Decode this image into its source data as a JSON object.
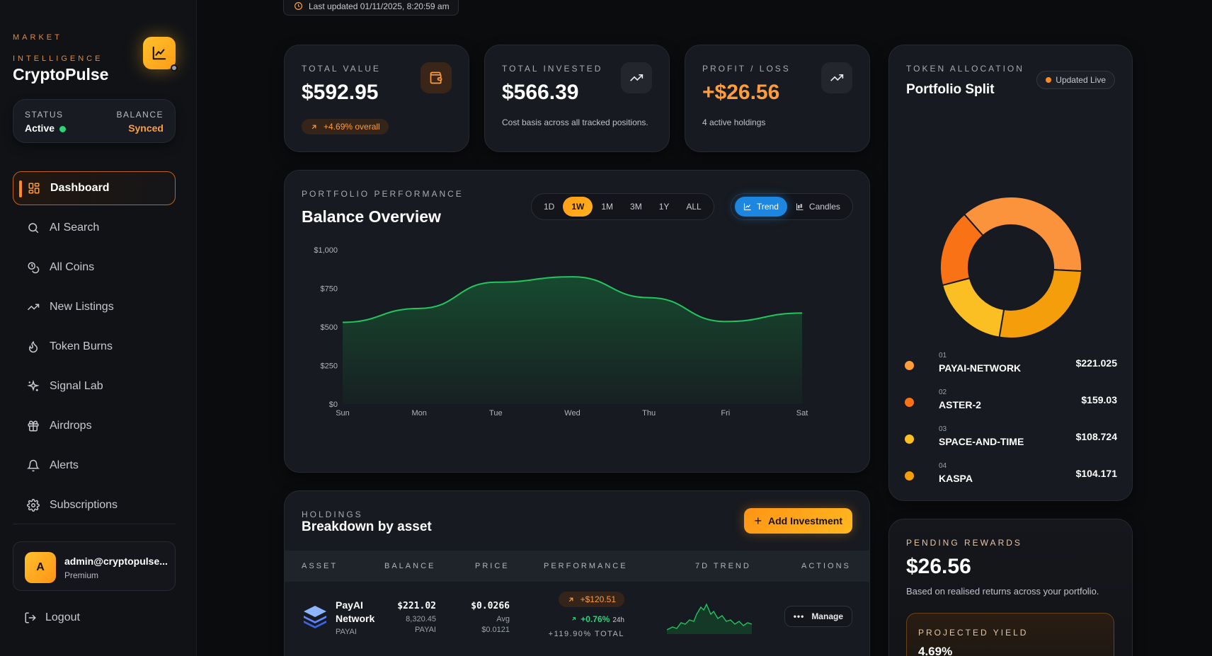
{
  "updated": "Last updated 01/11/2025, 8:20:59 am",
  "brand": {
    "tag": "MARKET INTELLIGENCE",
    "name": "CryptoPulse",
    "logo_icon": "chart-line-icon"
  },
  "status": {
    "status_label": "STATUS",
    "status_value": "Active",
    "balance_label": "BALANCE",
    "balance_value": "Synced"
  },
  "nav": [
    {
      "label": "Dashboard",
      "icon": "grid-icon"
    },
    {
      "label": "AI Search",
      "icon": "search-icon"
    },
    {
      "label": "All Coins",
      "icon": "coins-icon"
    },
    {
      "label": "New Listings",
      "icon": "trending-up-icon"
    },
    {
      "label": "Token Burns",
      "icon": "flame-icon"
    },
    {
      "label": "Signal Lab",
      "icon": "sparkles-icon"
    },
    {
      "label": "Airdrops",
      "icon": "gift-icon"
    },
    {
      "label": "Alerts",
      "icon": "bell-icon"
    },
    {
      "label": "Subscriptions",
      "icon": "gear-icon"
    }
  ],
  "user": {
    "initial": "A",
    "email": "admin@cryptopulse...",
    "plan": "Premium"
  },
  "logout": "Logout",
  "stats": {
    "total_value": {
      "label": "TOTAL VALUE",
      "value": "$592.95",
      "pill": "+4.69% overall"
    },
    "total_invested": {
      "label": "TOTAL INVESTED",
      "value": "$566.39",
      "sub": "Cost basis across all tracked positions."
    },
    "profit_loss": {
      "label": "PROFIT / LOSS",
      "value": "+$26.56",
      "sub": "4 active holdings"
    }
  },
  "performance": {
    "kicker": "PORTFOLIO PERFORMANCE",
    "title": "Balance Overview",
    "ranges": [
      "1D",
      "1W",
      "1M",
      "3M",
      "1Y",
      "ALL"
    ],
    "active_range": "1W",
    "modes": [
      "Trend",
      "Candles"
    ],
    "active_mode": "Trend"
  },
  "chart_data": {
    "type": "area",
    "x": [
      "Sun",
      "Mon",
      "Tue",
      "Wed",
      "Thu",
      "Fri",
      "Sat"
    ],
    "y_ticks": [
      "$0",
      "$250",
      "$500",
      "$750",
      "$1,000"
    ],
    "ylim": [
      0,
      1000
    ],
    "series": [
      {
        "values": [
          530,
          620,
          790,
          825,
          690,
          535,
          590
        ]
      }
    ],
    "color": "#22c55e"
  },
  "allocation": {
    "kicker": "TOKEN ALLOCATION",
    "title": "Portfolio Split",
    "live": "Updated Live",
    "chart_data": {
      "type": "pie",
      "items": [
        {
          "num": "01",
          "name": "PAYAI-NETWORK",
          "value": "$221.025",
          "amount": 221.025,
          "color": "#fb923c"
        },
        {
          "num": "02",
          "name": "ASTER-2",
          "value": "$159.03",
          "amount": 159.03,
          "color": "#f59e0b"
        },
        {
          "num": "03",
          "name": "SPACE-AND-TIME",
          "value": "$108.724",
          "amount": 108.724,
          "color": "#fbbf24"
        },
        {
          "num": "04",
          "name": "KASPA",
          "value": "$104.171",
          "amount": 104.171,
          "color": "#f97316"
        }
      ]
    }
  },
  "holdings": {
    "kicker": "HOLDINGS",
    "title": "Breakdown by asset",
    "add_label": "Add Investment",
    "columns": [
      "ASSET",
      "BALANCE",
      "PRICE",
      "PERFORMANCE",
      "7D TREND",
      "ACTIONS"
    ],
    "rows": [
      {
        "name": "PayAI Network",
        "symbol": "PAYAI",
        "balance": "$221.02",
        "balance_qty": "8,320.45",
        "balance_sym": "PAYAI",
        "price": "$0.0266",
        "avg_label": "Avg",
        "avg_price": "$0.0121",
        "perf_value": "+$120.51",
        "change_24h": "+0.76%",
        "change_24h_label": "24h",
        "total": "+119.90% TOTAL",
        "manage_label": "Manage"
      }
    ]
  },
  "rewards": {
    "kicker": "PENDING REWARDS",
    "value": "$26.56",
    "sub": "Based on realised returns across your portfolio.",
    "yield_kicker": "PROJECTED YIELD",
    "yield_value": "4.69%"
  }
}
